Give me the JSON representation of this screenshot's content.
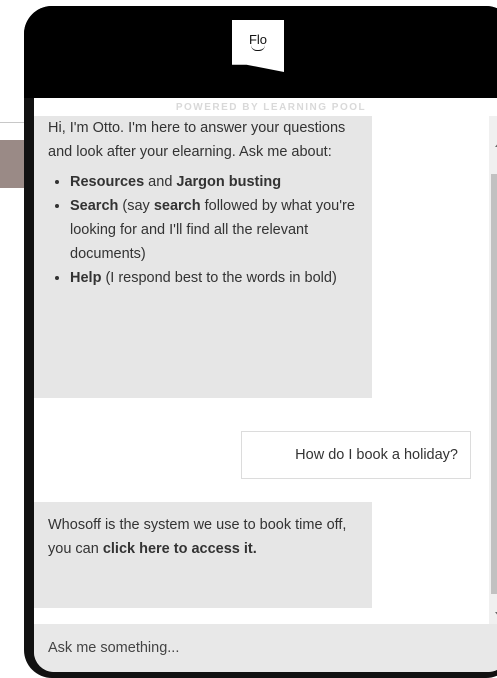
{
  "header": {
    "logo_text": "Flo",
    "powered_by": "POWERED BY LEARNING POOL"
  },
  "messages": {
    "intro": "Hi, I'm Otto. I'm here to answer your questions and look after your elearning. Ask me about:",
    "bullets": [
      {
        "bold": "Resources",
        "mid": " and ",
        "bold2": "Jargon busting",
        "rest": ""
      },
      {
        "bold": "Search",
        "mid": " (say ",
        "bold2": "search",
        "rest": " followed by what you're looking for and I'll find all the relevant documents)"
      },
      {
        "bold": "Help",
        "mid": " (I respond best to the words in bold)",
        "bold2": "",
        "rest": ""
      }
    ],
    "user_message": "How do I book a holiday?",
    "reply_text": "Whosoff is the system we use to book time off, you can ",
    "reply_link": "click here to access it."
  },
  "input": {
    "placeholder": "Ask me something..."
  },
  "colors": {
    "header_bg": "#000000",
    "bot_bubble": "#e6e6e6",
    "input_bar": "#e8e8e8"
  }
}
